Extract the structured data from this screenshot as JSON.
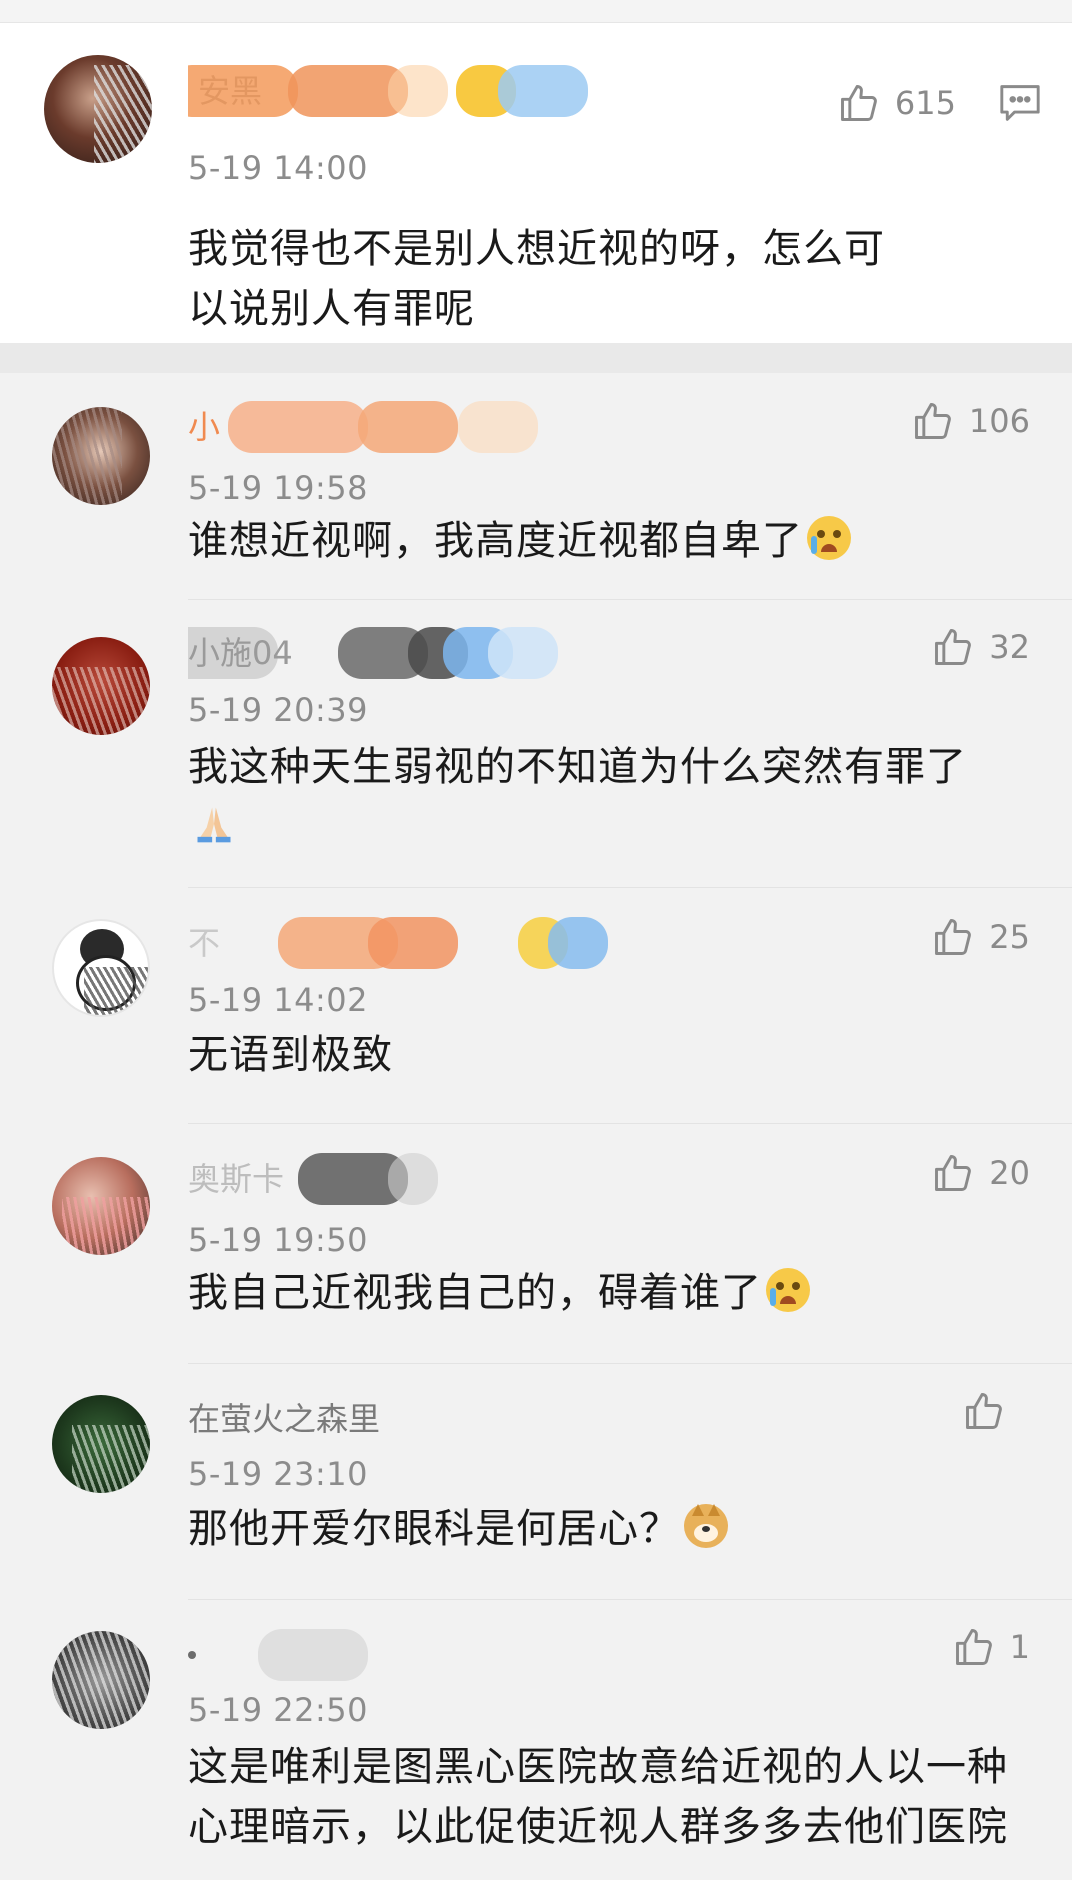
{
  "main_comment": {
    "username": "安黑",
    "time": "5-19 14:00",
    "likes": "615",
    "text": "我觉得也不是别人想近视的呀，怎么可以说别人有罪呢"
  },
  "replies": [
    {
      "username": "小",
      "time": "5-19 19:58",
      "likes": "106",
      "text": "谁想近视啊，我高度近视都自卑了",
      "emoji": "crying-face"
    },
    {
      "username": "小施04",
      "time": "5-19 20:39",
      "likes": "32",
      "text": "我这种天生弱视的不知道为什么突然有罪了",
      "emoji": "folded-hands"
    },
    {
      "username": "不",
      "time": "5-19 14:02",
      "likes": "25",
      "text": "无语到极致",
      "emoji": ""
    },
    {
      "username": "奥斯卡",
      "time": "5-19 19:50",
      "likes": "20",
      "text": "我自己近视我自己的，碍着谁了",
      "emoji": "crying-face"
    },
    {
      "username": "在萤火之森里",
      "time": "5-19 23:10",
      "likes": "",
      "text": "那他开爱尔眼科是何居心？",
      "emoji": "doge"
    },
    {
      "username": "",
      "time": "5-19 22:50",
      "likes": "1",
      "text": "这是唯利是图黑心医院故意给近视的人以一种心理暗示，以此促使近视人群多多去他们医院",
      "emoji": ""
    }
  ],
  "icons": {
    "like": "thumbs-up-outline-icon",
    "reply": "comment-bubble-icon"
  },
  "colors": {
    "text": "#1a1a1a",
    "meta": "#8c8c8c",
    "background": "#f2f2f2",
    "card": "#ffffff"
  }
}
